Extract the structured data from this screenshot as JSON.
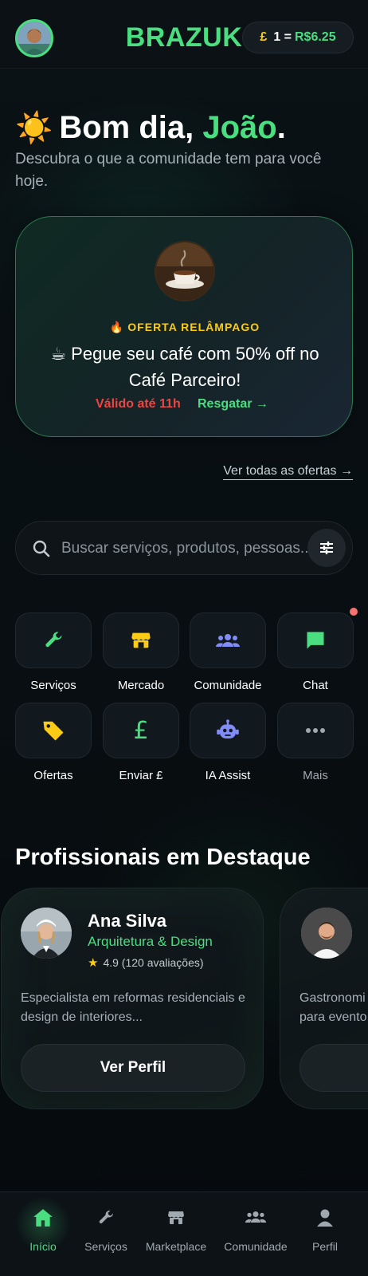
{
  "header": {
    "brand": "BRAZUK",
    "rate_symbol": "£",
    "rate_text": "1 =",
    "rate_value": "R$6.25"
  },
  "greeting": {
    "prefix": "Bom dia,",
    "name": "João",
    "suffix": ".",
    "subtitle": "Descubra o que a comunidade tem para você hoje."
  },
  "offer": {
    "tag": "OFERTA RELÂMPAGO",
    "headline": "☕ Pegue seu café com 50% off no Café Parceiro!",
    "valid": "Válido até 11h",
    "redeem": "Resgatar →"
  },
  "see_all": "Ver todas as ofertas →",
  "search": {
    "placeholder": "Buscar serviços, produtos, pessoas..."
  },
  "categories": [
    {
      "label": "Serviços",
      "icon": "wrench-icon"
    },
    {
      "label": "Mercado",
      "icon": "store-icon"
    },
    {
      "label": "Comunidade",
      "icon": "people-icon"
    },
    {
      "label": "Chat",
      "icon": "chat-icon"
    },
    {
      "label": "Ofertas",
      "icon": "tag-icon"
    },
    {
      "label": "Enviar £",
      "icon": "pound-icon"
    },
    {
      "label": "IA Assist",
      "icon": "robot-icon"
    },
    {
      "label": "Mais",
      "icon": "more-icon"
    }
  ],
  "pros": {
    "title": "Profissionais em Destaque",
    "items": [
      {
        "name": "Ana Silva",
        "role": "Arquitetura & Design",
        "rating": "4.9 (120 avaliações)",
        "description": "Especialista em reformas residenciais e design de interiores...",
        "button": "Ver Perfil"
      },
      {
        "name": "",
        "role": "",
        "rating": "",
        "description": "Gastronomi para evento",
        "button": ""
      }
    ]
  },
  "nav": [
    {
      "label": "Início",
      "icon": "home-icon"
    },
    {
      "label": "Serviços",
      "icon": "wrench-icon"
    },
    {
      "label": "Marketplace",
      "icon": "store-icon"
    },
    {
      "label": "Comunidade",
      "icon": "people-icon"
    },
    {
      "label": "Perfil",
      "icon": "person-icon"
    }
  ],
  "colors": {
    "accent": "#4ade80",
    "warning": "#facc15",
    "danger": "#ef4444",
    "background": "#080d10"
  }
}
